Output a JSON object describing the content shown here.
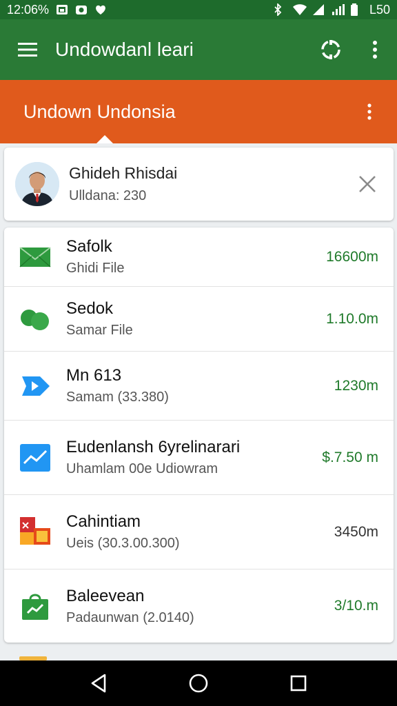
{
  "status_bar": {
    "left_text": "12:06%",
    "right_text": "L50",
    "icons_left": [
      "gallery-icon",
      "camera-icon",
      "shield-icon"
    ],
    "icons_right": [
      "bluetooth-icon",
      "wifi-icon",
      "signal-icon",
      "battery-icon"
    ]
  },
  "app_bar": {
    "title": "Undowdanl leari"
  },
  "sub_bar": {
    "title": "Undown Undonsia"
  },
  "profile": {
    "name": "Ghideh Rhisdai",
    "subtitle": "Ulldana: 230"
  },
  "items": [
    {
      "title": "Safolk",
      "subtitle": "Ghidi File",
      "value": "16600m",
      "icon": "envelope-icon",
      "accent": "#2e9a3e"
    },
    {
      "title": "Sedok",
      "subtitle": "Samar File",
      "value": "1.10.0m",
      "icon": "circles-icon",
      "accent": "#2e9a3e"
    },
    {
      "title": "Mn 613",
      "subtitle": "Samam (33.380)",
      "value": "1230m",
      "icon": "play-icon",
      "accent": "#2196f3"
    },
    {
      "title": "Eudenlansh 6yrelinarari",
      "subtitle": "Uhamlam 00e Udiowram",
      "value": "$.7.50 m",
      "icon": "trend-chart-icon",
      "accent": "#2196f3"
    },
    {
      "title": "Cahintiam",
      "subtitle": "Ueis (30.3.00.300)",
      "value": "3450m",
      "icon": "grid-tiles-icon",
      "accent": "#d32f2f"
    },
    {
      "title": "Baleevean",
      "subtitle": "Padaunwan (2.0140)",
      "value": "3/10.m",
      "icon": "shopping-bag-icon",
      "accent": "#2e9a3e"
    }
  ],
  "colors": {
    "app_bar": "#2a7a36",
    "status_bar": "#1e6b2c",
    "sub_bar": "#e05a1c",
    "value_green": "#1f7a2a"
  },
  "nav": [
    "back-icon",
    "home-icon",
    "recents-icon"
  ]
}
